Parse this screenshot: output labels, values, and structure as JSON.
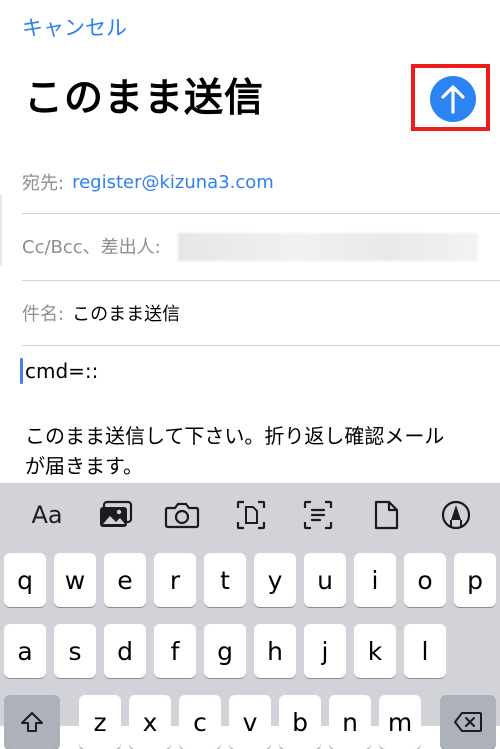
{
  "header": {
    "cancel_label": "キャンセル",
    "title": "このまま送信",
    "send_icon": "arrow-up-icon"
  },
  "fields": {
    "to_label": "宛先:",
    "to_value": "register@kizuna3.com",
    "ccbcc_label": "Cc/Bcc、差出人:",
    "subject_label": "件名:",
    "subject_value": "このまま送信"
  },
  "body": {
    "line1": "cmd=::",
    "line2": "このまま送信して下さい。折り返し確認メール",
    "line3": "が届きます。"
  },
  "keyboard": {
    "toolbar": {
      "format_label": "Aa",
      "icons": [
        "photo-library-icon",
        "camera-icon",
        "scan-document-icon",
        "scan-text-icon",
        "document-icon",
        "markup-icon"
      ]
    },
    "row1": [
      "q",
      "w",
      "e",
      "r",
      "t",
      "y",
      "u",
      "i",
      "o",
      "p"
    ],
    "row2": [
      "a",
      "s",
      "d",
      "f",
      "g",
      "h",
      "j",
      "k",
      "l"
    ],
    "row3": [
      "z",
      "x",
      "c",
      "v",
      "b",
      "n",
      "m"
    ]
  },
  "colors": {
    "accent": "#2f7ff0",
    "send_button": "#2c84f2",
    "highlight_border": "#ef1c1c",
    "keyboard_bg": "#d1d3d9"
  }
}
